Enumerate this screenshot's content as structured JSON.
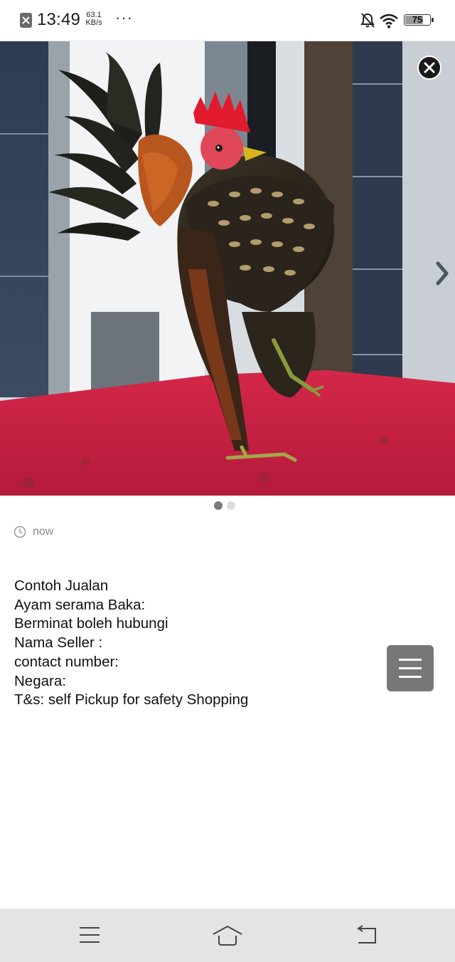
{
  "status_bar": {
    "time": "13:49",
    "speed_value": "63.1",
    "speed_unit": "KB/s",
    "overflow": "···",
    "battery": "75",
    "battery_level": 0.75,
    "icons": [
      "notification-dismiss-icon",
      "bell-off-icon",
      "wifi-icon",
      "battery-icon"
    ]
  },
  "gallery": {
    "image_subject": "rooster photo",
    "page_count": 2,
    "current_page": 1,
    "colors": {
      "dot_active": "#7a7a7a",
      "dot_inactive": "#dcdcdc"
    }
  },
  "post": {
    "timestamp": "now",
    "lines": [
      "Contoh Jualan",
      "Ayam serama Baka:",
      "Berminat boleh hubungi",
      "Nama Seller :",
      "contact number:",
      "Negara:",
      "T&s: self Pickup for safety Shopping"
    ]
  },
  "nav_bar": {
    "icons": [
      "menu-icon",
      "home-icon",
      "back-icon"
    ]
  }
}
